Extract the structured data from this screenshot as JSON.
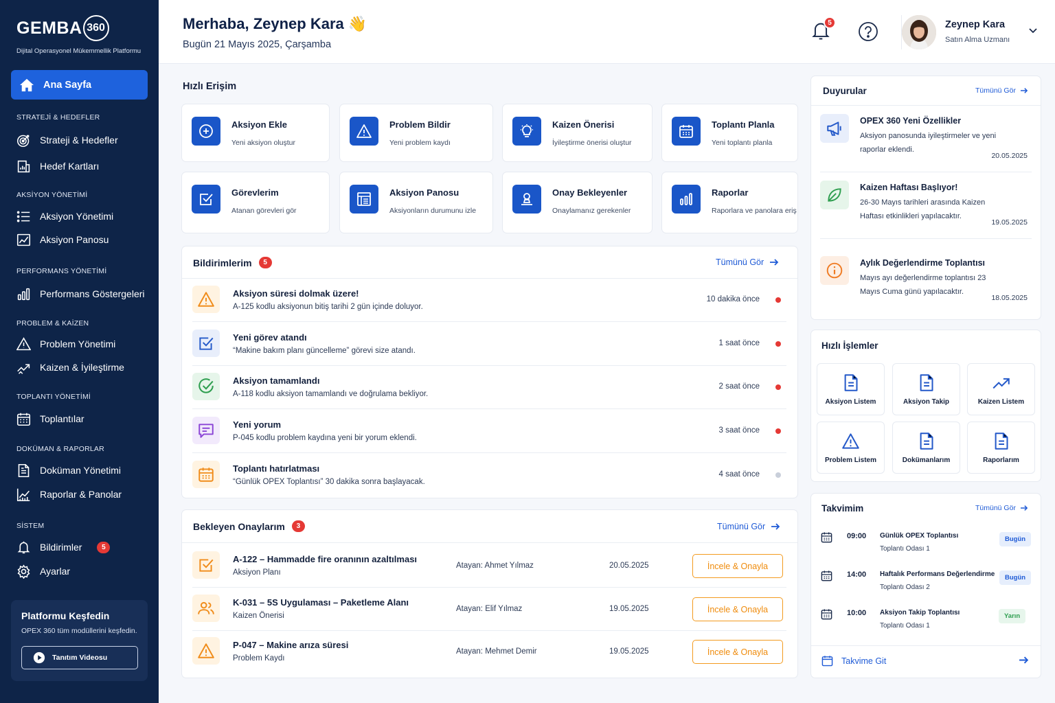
{
  "brand": {
    "name": "GEMBA",
    "ring": "360",
    "tagline": "Dijital Operasyonel Mükemmellik Platformu"
  },
  "sidebar": {
    "active": {
      "label": "Ana Sayfa",
      "icon": "home-icon"
    },
    "sections": [
      {
        "title": "STRATEJİ & HEDEFLER",
        "items": [
          {
            "label": "Strateji & Hedefler",
            "icon": "target-icon"
          },
          {
            "label": "Hedef Kartları",
            "icon": "building-chart-icon"
          }
        ]
      },
      {
        "title": "AKSİYON YÖNETİMİ",
        "items": [
          {
            "label": "Aksiyon Yönetimi",
            "icon": "list-icon"
          },
          {
            "label": "Aksiyon Panosu",
            "icon": "chart-board-icon"
          }
        ]
      },
      {
        "title": "PERFORMANS YÖNETİMİ",
        "items": [
          {
            "label": "Performans Göstergeleri",
            "icon": "bar-chart-icon"
          }
        ]
      },
      {
        "title": "PROBLEM & KAİZEN",
        "items": [
          {
            "label": "Problem Yönetimi",
            "icon": "warning-icon"
          },
          {
            "label": "Kaizen & İyileştirme",
            "icon": "trend-up-icon"
          }
        ]
      },
      {
        "title": "TOPLANTI YÖNETİMİ",
        "items": [
          {
            "label": "Toplantılar",
            "icon": "calendar-icon"
          }
        ]
      },
      {
        "title": "DOKÜMAN & RAPORLAR",
        "items": [
          {
            "label": "Doküman Yönetimi",
            "icon": "document-icon"
          },
          {
            "label": "Raporlar & Panolar",
            "icon": "line-chart-icon"
          }
        ]
      },
      {
        "title": "SİSTEM",
        "items": [
          {
            "label": "Bildirimler",
            "icon": "bell-icon",
            "badge": "5"
          },
          {
            "label": "Ayarlar",
            "icon": "gear-icon"
          }
        ]
      }
    ],
    "promo": {
      "title": "Platformu Keşfedin",
      "text": "OPEX 360 tüm modüllerini keşfedin.",
      "button": "Tanıtım Videosu"
    }
  },
  "header": {
    "greeting": "Merhaba, Zeynep Kara 👋",
    "date": "Bugün 21 Mayıs 2025, Çarşamba",
    "notif_count": "5",
    "user": {
      "name": "Zeynep Kara",
      "role": "Satın Alma Uzmanı"
    }
  },
  "quick_access": {
    "title": "Hızlı Erişim",
    "items": [
      {
        "label": "Aksiyon Ekle",
        "sub": "Yeni aksiyon oluştur",
        "icon": "plus-circle-icon"
      },
      {
        "label": "Problem Bildir",
        "sub": "Yeni problem kaydı",
        "icon": "warning-icon"
      },
      {
        "label": "Kaizen Önerisi",
        "sub": "İyileştirme önerisi oluştur",
        "icon": "lightbulb-icon"
      },
      {
        "label": "Toplantı Planla",
        "sub": "Yeni toplantı planla",
        "icon": "calendar-icon"
      },
      {
        "label": "Görevlerim",
        "sub": "Atanan görevleri gör",
        "icon": "checkbox-icon"
      },
      {
        "label": "Aksiyon Panosu",
        "sub": "Aksiyonların durumunu izle",
        "icon": "board-icon"
      },
      {
        "label": "Onay Bekleyenler",
        "sub": "Onaylamanız gerekenler",
        "icon": "user-stamp-icon"
      },
      {
        "label": "Raporlar",
        "sub": "Raporlara ve panolara eriş",
        "icon": "bar-chart-icon"
      }
    ]
  },
  "notifications": {
    "title": "Bildirimlerim",
    "count": "5",
    "see_all": "Tümünü Gör",
    "items": [
      {
        "title": "Aksiyon süresi dolmak üzere!",
        "desc": "A-125 kodlu aksiyonun bitiş tarihi 2 gün içinde doluyor.",
        "time": "10 dakika önce",
        "icon": "warning-icon",
        "unread": true
      },
      {
        "title": "Yeni görev atandı",
        "desc": "“Makine bakım planı güncelleme” görevi size atandı.",
        "time": "1 saat önce",
        "icon": "checkbox-icon",
        "unread": true
      },
      {
        "title": "Aksiyon tamamlandı",
        "desc": "A-118 kodlu aksiyon tamamlandı ve doğrulama bekliyor.",
        "time": "2 saat önce",
        "icon": "check-circle-icon",
        "unread": true
      },
      {
        "title": "Yeni yorum",
        "desc": "P-045 kodlu problem kaydına yeni bir yorum eklendi.",
        "time": "3 saat önce",
        "icon": "comment-icon",
        "unread": true
      },
      {
        "title": "Toplantı hatırlatması",
        "desc": "“Günlük OPEX Toplantısı” 30 dakika sonra başlayacak.",
        "time": "4 saat önce",
        "icon": "calendar-icon",
        "unread": false
      }
    ]
  },
  "approvals": {
    "title": "Bekleyen Onaylarım",
    "count": "3",
    "see_all": "Tümünü Gör",
    "items": [
      {
        "title": "A-122 – Hammadde fire oranının azaltılması",
        "type": "Aksiyon Planı",
        "assigner": "Atayan: Ahmet Yılmaz",
        "date": "20.05.2025",
        "button": "İncele & Onayla",
        "icon": "checkbox-icon"
      },
      {
        "title": "K-031 – 5S Uygulaması – Paketleme Alanı",
        "type": "Kaizen Önerisi",
        "assigner": "Atayan: Elif Yılmaz",
        "date": "19.05.2025",
        "button": "İncele & Onayla",
        "icon": "users-icon"
      },
      {
        "title": "P-047 – Makine arıza süresi",
        "type": "Problem Kaydı",
        "assigner": "Atayan: Mehmet Demir",
        "date": "19.05.2025",
        "button": "İncele & Onayla",
        "icon": "warning-icon"
      }
    ]
  },
  "announcements": {
    "title": "Duyurular",
    "see_all": "Tümünü Gör",
    "items": [
      {
        "title": "OPEX 360 Yeni Özellikler",
        "text": "Aksiyon panosunda iyileştirmeler ve yeni raporlar eklendi.",
        "date": "20.05.2025",
        "icon": "megaphone-icon"
      },
      {
        "title": "Kaizen Haftası Başlıyor!",
        "text": "26-30 Mayıs tarihleri arasında Kaizen Haftası etkinlikleri yapılacaktır.",
        "date": "19.05.2025",
        "icon": "leaf-icon"
      },
      {
        "title": "Aylık Değerlendirme Toplantısı",
        "text": "Mayıs ayı değerlendirme toplantısı 23 Mayıs Cuma günü yapılacaktır.",
        "date": "18.05.2025",
        "icon": "info-icon"
      }
    ]
  },
  "quick_ops": {
    "title": "Hızlı İşlemler",
    "items": [
      {
        "label": "Aksiyon Listem",
        "icon": "file-icon"
      },
      {
        "label": "Aksiyon Takip",
        "icon": "file-icon"
      },
      {
        "label": "Kaizen Listem",
        "icon": "trend-up-icon"
      },
      {
        "label": "Problem Listem",
        "icon": "warning-icon"
      },
      {
        "label": "Dokümanlarım",
        "icon": "file-icon"
      },
      {
        "label": "Raporlarım",
        "icon": "file-icon"
      }
    ]
  },
  "calendar": {
    "title": "Takvimim",
    "see_all": "Tümünü Gör",
    "go": "Takvime Git",
    "items": [
      {
        "time": "09:00",
        "title": "Günlük OPEX Toplantısı",
        "room": "Toplantı Odası 1",
        "tag": "Bugün"
      },
      {
        "time": "14:00",
        "title": "Haftalık Performans Değerlendirme",
        "room": "Toplantı Odası 2",
        "tag": "Bugün"
      },
      {
        "time": "10:00",
        "title": "Aksiyon Takip Toplantısı",
        "room": "Toplantı Odası 1",
        "tag": "Yarın"
      }
    ]
  },
  "colors": {
    "sidebar": "#0e2448",
    "accent": "#1e62dd",
    "orange": "#f39a1e",
    "danger": "#e53935",
    "green": "#2e9e4f",
    "purple": "#8b45d6"
  }
}
